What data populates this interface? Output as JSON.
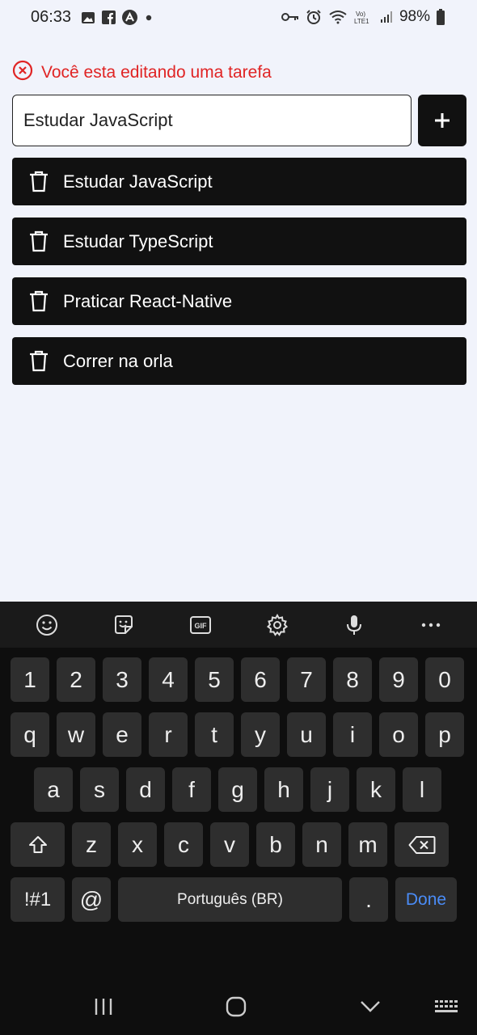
{
  "status_bar": {
    "time": "06:33",
    "battery": "98%",
    "left_icons": [
      "gallery-icon",
      "facebook-icon",
      "app-icon",
      "dot-icon"
    ],
    "right_icons": [
      "vpn-key-icon",
      "alarm-icon",
      "wifi-icon",
      "volte-icon",
      "signal-icon",
      "battery-icon"
    ]
  },
  "banner": {
    "text": "Você esta editando uma tarefa",
    "color": "#e02424"
  },
  "input": {
    "value": "Estudar JavaScript",
    "placeholder": ""
  },
  "add_button": {
    "label": "+"
  },
  "tasks": [
    {
      "label": "Estudar JavaScript"
    },
    {
      "label": "Estudar TypeScript"
    },
    {
      "label": "Praticar React-Native"
    },
    {
      "label": "Correr na orla"
    }
  ],
  "keyboard": {
    "toolbar": [
      "emoji-icon",
      "sticker-icon",
      "gif-icon",
      "settings-icon",
      "mic-icon",
      "more-icon"
    ],
    "gif_label": "GIF",
    "row_numbers": [
      "1",
      "2",
      "3",
      "4",
      "5",
      "6",
      "7",
      "8",
      "9",
      "0"
    ],
    "row_q": [
      "q",
      "w",
      "e",
      "r",
      "t",
      "y",
      "u",
      "i",
      "o",
      "p"
    ],
    "row_a": [
      "a",
      "s",
      "d",
      "f",
      "g",
      "h",
      "j",
      "k",
      "l"
    ],
    "row_z": [
      "z",
      "x",
      "c",
      "v",
      "b",
      "n",
      "m"
    ],
    "symbols_label": "!#1",
    "at_label": "@",
    "space_label": "Português (BR)",
    "dot_label": ".",
    "done_label": "Done",
    "accent_color": "#4a8cf7"
  },
  "navbar": [
    "recents-icon",
    "home-icon",
    "back-icon",
    "keyboard-icon"
  ]
}
